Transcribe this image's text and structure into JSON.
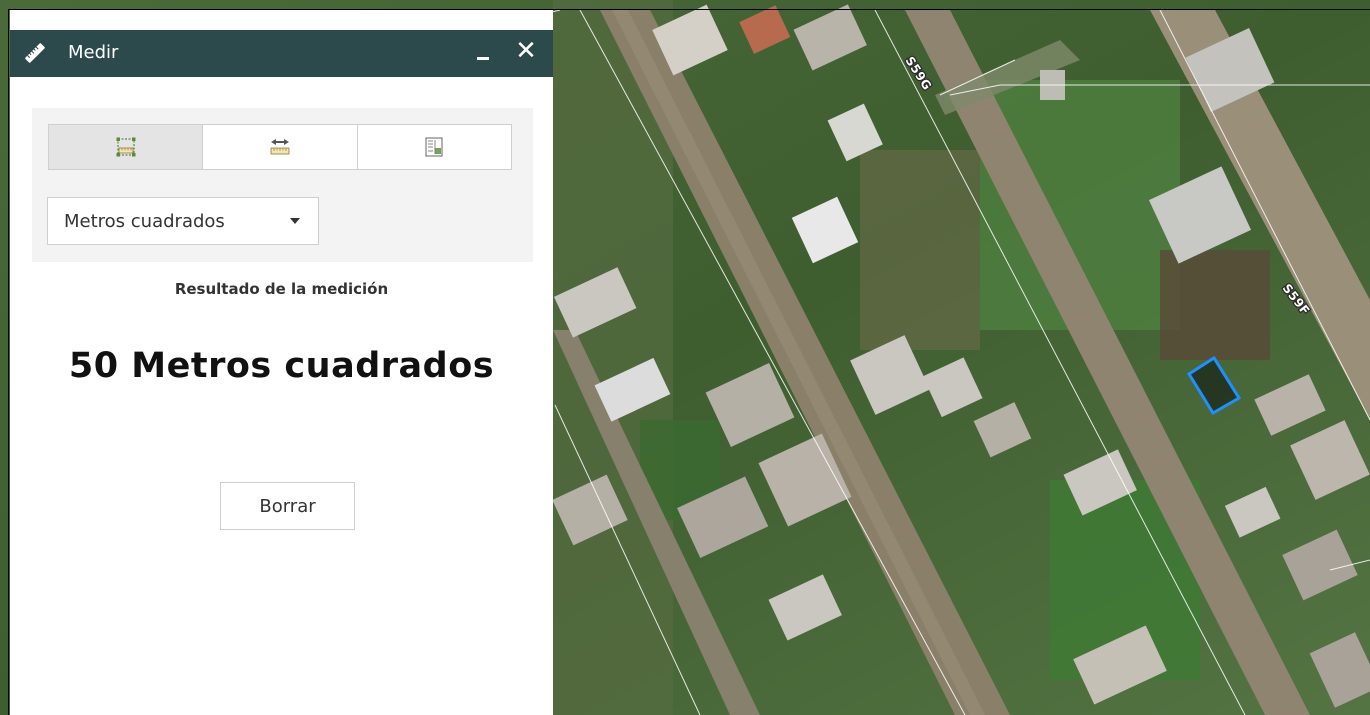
{
  "panel": {
    "title": "Medir",
    "tools": [
      {
        "name": "area",
        "active": true
      },
      {
        "name": "distance",
        "active": false
      },
      {
        "name": "location",
        "active": false
      }
    ],
    "unit_selected": "Metros cuadrados",
    "result_heading": "Resultado de la medición",
    "result_value": "50 Metros cuadrados",
    "clear_label": "Borrar"
  },
  "map": {
    "road_labels": [
      "S59G",
      "S59F"
    ]
  },
  "colors": {
    "header": "#2c4a4b",
    "measure_polygon": "#1e90ff",
    "tool_icon": "#5a8a3a"
  }
}
